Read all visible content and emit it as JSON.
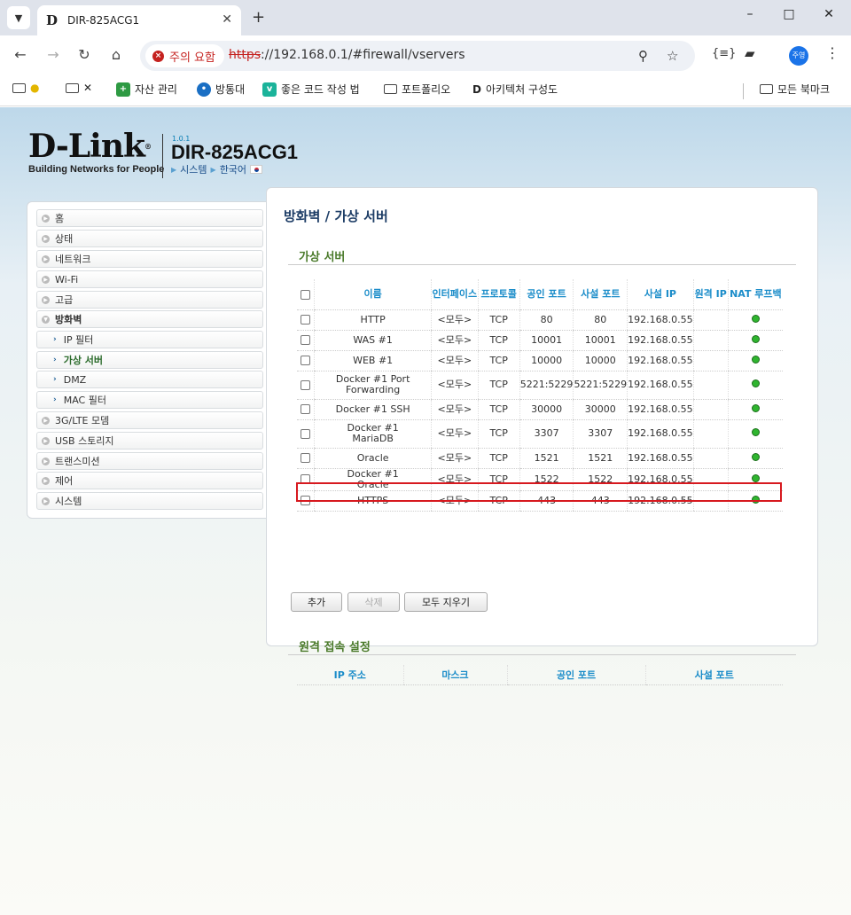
{
  "browser": {
    "tab_title": "DIR-825ACG1",
    "favicon_letter": "D",
    "security_label": "주의 요함",
    "url_scheme": "https",
    "url_rest": "://192.168.0.1/#firewall/vservers",
    "profile_initials": "주영",
    "bookmarks": [
      "",
      "",
      "자산 관리",
      "방통대",
      "좋은 코드 작성 법",
      "포트폴리오",
      "아키텍처 구성도",
      "모든 북마크"
    ]
  },
  "header": {
    "logo_word": "D-Link",
    "logo_tagline": "Building Networks for People",
    "fw_version": "1.0.1",
    "model": "DIR-825ACG1",
    "link_system": "시스템",
    "link_language": "한국어"
  },
  "sidebar": {
    "items": [
      "홈",
      "상태",
      "네트워크",
      "Wi-Fi",
      "고급",
      "방화벽",
      "IP 필터",
      "가상 서버",
      "DMZ",
      "MAC 필터",
      "3G/LTE 모뎀",
      "USB 스토리지",
      "트랜스미션",
      "제어",
      "시스템"
    ]
  },
  "main": {
    "page_title": "방화벽 /  가상 서버",
    "section_virtual_server": "가상 서버",
    "columns": [
      "이름",
      "인터페이스",
      "프로토콜",
      "공인 포트",
      "사설 포트",
      "사설 IP",
      "원격 IP",
      "NAT 루프백"
    ],
    "rows": [
      {
        "name": "HTTP",
        "iface": "<모두>",
        "proto": "TCP",
        "pub": "80",
        "priv": "80",
        "ip": "192.168.0.55",
        "remote": ""
      },
      {
        "name": "WAS #1",
        "iface": "<모두>",
        "proto": "TCP",
        "pub": "10001",
        "priv": "10001",
        "ip": "192.168.0.55",
        "remote": ""
      },
      {
        "name": "WEB #1",
        "iface": "<모두>",
        "proto": "TCP",
        "pub": "10000",
        "priv": "10000",
        "ip": "192.168.0.55",
        "remote": ""
      },
      {
        "name": "Docker #1 Port Forwarding",
        "iface": "<모두>",
        "proto": "TCP",
        "pub": "5221:5229",
        "priv": "5221:5229",
        "ip": "192.168.0.55",
        "remote": ""
      },
      {
        "name": "Docker #1 SSH",
        "iface": "<모두>",
        "proto": "TCP",
        "pub": "30000",
        "priv": "30000",
        "ip": "192.168.0.55",
        "remote": ""
      },
      {
        "name": "Docker #1 MariaDB",
        "iface": "<모두>",
        "proto": "TCP",
        "pub": "3307",
        "priv": "3307",
        "ip": "192.168.0.55",
        "remote": ""
      },
      {
        "name": "Oracle",
        "iface": "<모두>",
        "proto": "TCP",
        "pub": "1521",
        "priv": "1521",
        "ip": "192.168.0.55",
        "remote": ""
      },
      {
        "name": "Docker #1 Oracle",
        "iface": "<모두>",
        "proto": "TCP",
        "pub": "1522",
        "priv": "1522",
        "ip": "192.168.0.55",
        "remote": ""
      },
      {
        "name": "HTTPS",
        "iface": "<모두>",
        "proto": "TCP",
        "pub": "443",
        "priv": "443",
        "ip": "192.168.0.55",
        "remote": ""
      }
    ],
    "buttons": {
      "add": "추가",
      "delete": "삭제",
      "clear_all": "모두 지우기"
    },
    "section_remote_access": "원격 접속 설정",
    "remote_columns": [
      "IP 주소",
      "마스크",
      "공인 포트",
      "사설 포트"
    ]
  },
  "colors": {
    "accent_blue": "#1a8cc9",
    "section_green": "#4a7a2a",
    "highlight_red": "#d7191f",
    "led_green": "#2fb52f"
  }
}
